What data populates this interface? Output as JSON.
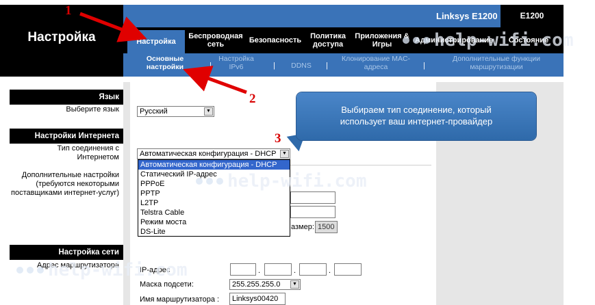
{
  "window": {
    "brand": "Linksys E1200",
    "model": "E1200",
    "page_title": "Настройка"
  },
  "tabs": [
    {
      "label": "Настройка",
      "active": true
    },
    {
      "label": "Беспроводная сеть"
    },
    {
      "label": "Безопасность"
    },
    {
      "label": "Политика доступа"
    },
    {
      "label": "Приложения & Игры"
    },
    {
      "label": "Администрирование"
    },
    {
      "label": "Состояние"
    }
  ],
  "subnav": [
    {
      "label": "Основные настройки",
      "active": true
    },
    {
      "label": "Настройка IPv6"
    },
    {
      "label": "DDNS"
    },
    {
      "label": "Клонирование MAC-адреса"
    },
    {
      "label": "Дополнительные функции маршрутизации"
    }
  ],
  "sections": {
    "language": {
      "head": "Язык",
      "label": "Выберите язык",
      "value": "Русский"
    },
    "internet": {
      "head": "Настройки Интернета",
      "conn_label": "Тип соединения с Интернетом",
      "conn_value": "Автоматическая конфигурация - DHCP",
      "extra_label": "Дополнительные настройки (требуются некоторыми поставщиками интернет-услуг)",
      "mtu_label": "азмер:",
      "mtu_value": "1500"
    },
    "network": {
      "head": "Настройка сети",
      "router_addr_label": "Адрес маршрутизатора",
      "ip_label": "IP-адрес",
      "ip_parts": [
        "",
        "",
        "",
        ""
      ],
      "mask_label": "Маска подсети:",
      "mask_value": "255.255.255.0",
      "hostname_label": "Имя маршрутизатора :",
      "hostname_value": "Linksys00420"
    }
  },
  "dropdown_options": [
    {
      "label": "Автоматическая конфигурация - DHCP",
      "selected": true
    },
    {
      "label": "Статический IP-адрес"
    },
    {
      "label": "PPPoE"
    },
    {
      "label": "PPTP"
    },
    {
      "label": "L2TP"
    },
    {
      "label": "Telstra Cable"
    },
    {
      "label": "Режим моста"
    },
    {
      "label": "DS-Lite"
    }
  ],
  "callout": {
    "line1": "Выбираем тип соединение, который",
    "line2": "использует ваш интернет-провайдер"
  },
  "markers": {
    "n1": "1",
    "n2": "2",
    "n3": "3"
  },
  "watermark": "help-wifi.com",
  "colors": {
    "brand_blue": "#3a73b8",
    "marker_red": "#d80000",
    "selection_blue": "#3366cc"
  }
}
